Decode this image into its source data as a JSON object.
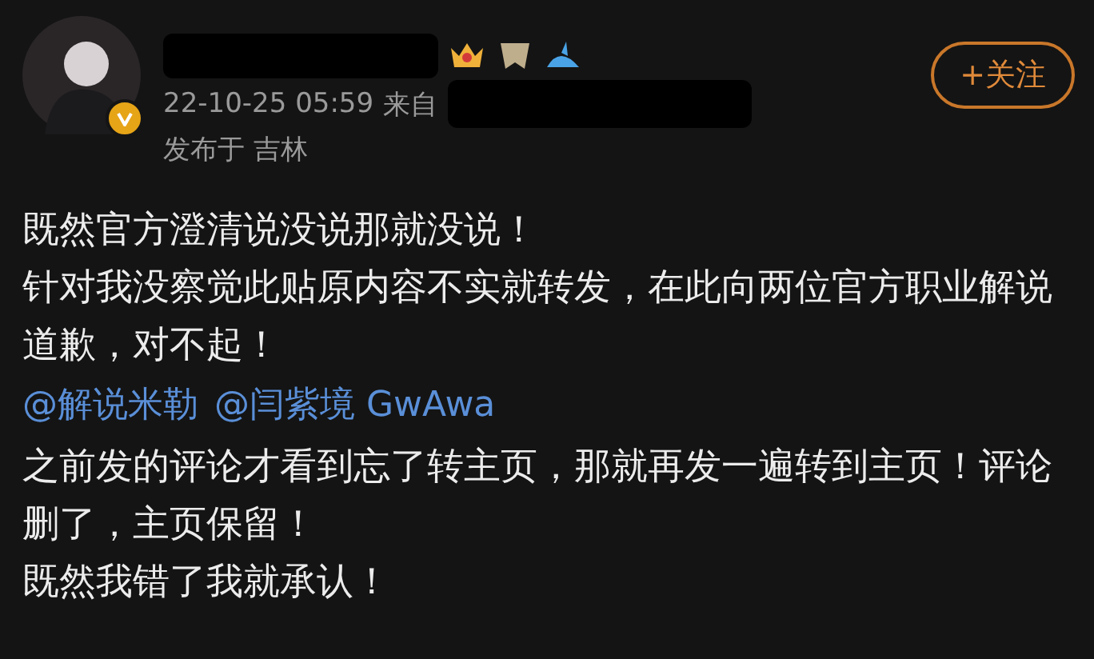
{
  "post": {
    "timestamp": "22-10-25 05:59",
    "source_prefix": "来自",
    "location": "发布于 吉林",
    "verified": true,
    "follow_button": "+关注"
  },
  "body": [
    {
      "kind": "text",
      "text": "既然官方澄清说没说那就没说！"
    },
    {
      "kind": "text",
      "text": "针对我没察觉此贴原内容不实就转发，在此向两位官方职业解说道歉，对不起！"
    },
    {
      "kind": "mentions",
      "items": [
        "@解说米勒",
        "@闫紫境 GwAwa"
      ]
    },
    {
      "kind": "text",
      "text": "之前发的评论才看到忘了转主页，那就再发一遍转到主页！评论删了，主页保留！"
    },
    {
      "kind": "text",
      "text": "既然我错了我就承认！"
    }
  ]
}
